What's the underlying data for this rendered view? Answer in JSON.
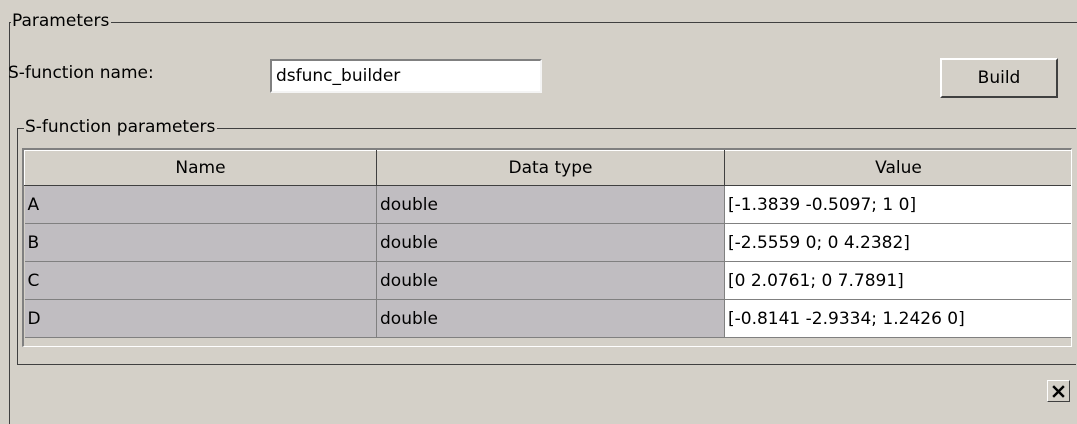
{
  "parameters_group": {
    "title": "Parameters"
  },
  "sfunction_name": {
    "label": "S-function name:",
    "value": "dsfunc_builder"
  },
  "build_button": {
    "label": "Build"
  },
  "sfunction_parameters": {
    "title": "S-function parameters",
    "columns": [
      "Name",
      "Data type",
      "Value"
    ],
    "rows": [
      {
        "name": "A",
        "data_type": "double",
        "value": "[-1.3839 -0.5097; 1 0]"
      },
      {
        "name": "B",
        "data_type": "double",
        "value": "[-2.5559 0; 0 4.2382]"
      },
      {
        "name": "C",
        "data_type": "double",
        "value": "[0 2.0761; 0 7.7891]"
      },
      {
        "name": "D",
        "data_type": "double",
        "value": "[-0.8141 -2.9334; 1.2426 0]"
      }
    ]
  },
  "close_button": {
    "icon": "close-icon"
  },
  "colors": {
    "panel_background": "#d4d0c8",
    "readonly_cell": "#c0bdc1",
    "editable_cell": "#ffffff"
  }
}
